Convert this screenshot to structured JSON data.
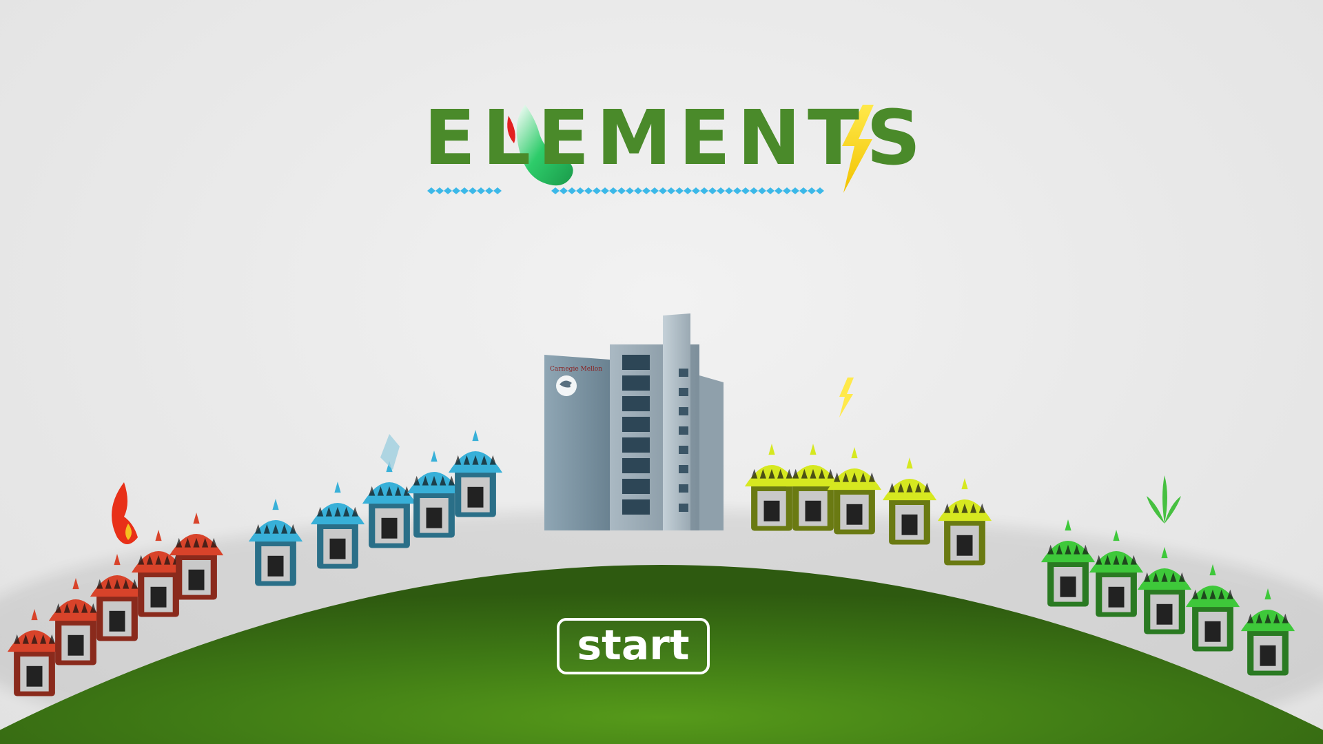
{
  "game": {
    "title": "ELEMENTS",
    "start_label": "start",
    "building_sign": "Carnegie Mellon"
  },
  "colors": {
    "background": "#e8e8e8",
    "title_green": "#4a8a2a",
    "ground_green": "#4a8a1a",
    "fire_red": "#d0402a",
    "water_blue": "#30a8d0",
    "lightning_yellow": "#d8e020",
    "earth_green": "#40c030",
    "wave_blue": "#3bb8e8"
  },
  "elements": [
    "fire",
    "water",
    "lightning",
    "earth"
  ]
}
